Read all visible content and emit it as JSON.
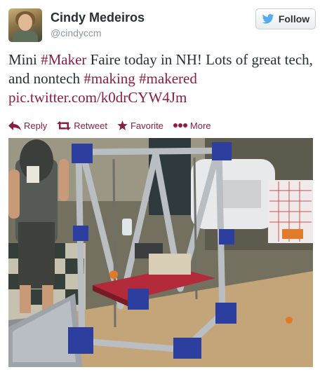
{
  "user": {
    "name": "Cindy Medeiros",
    "handle": "@cindyccm"
  },
  "follow_button": {
    "label": "Follow"
  },
  "tweet": {
    "text_parts": [
      {
        "kind": "text",
        "value": "Mini "
      },
      {
        "kind": "hashtag",
        "value": "#Maker"
      },
      {
        "kind": "text",
        "value": " Faire today in NH! Lots of great tech, and nontech "
      },
      {
        "kind": "hashtag",
        "value": "#making"
      },
      {
        "kind": "text",
        "value": " "
      },
      {
        "kind": "hashtag",
        "value": "#makered"
      },
      {
        "kind": "text",
        "value": " "
      },
      {
        "kind": "link",
        "value": "pic.twitter.com/k0drCYW4Jm"
      }
    ]
  },
  "actions": {
    "reply": {
      "label": "Reply",
      "icon": "reply-arrow-icon"
    },
    "retweet": {
      "label": "Retweet",
      "icon": "retweet-icon"
    },
    "favorite": {
      "label": "Favorite",
      "icon": "star-icon"
    },
    "more": {
      "label": "More",
      "icon": "ellipsis-icon"
    }
  },
  "colors": {
    "link": "#8b1d46",
    "name": "#292f33",
    "handle": "#8899a6",
    "twitter_blue": "#55acee"
  }
}
